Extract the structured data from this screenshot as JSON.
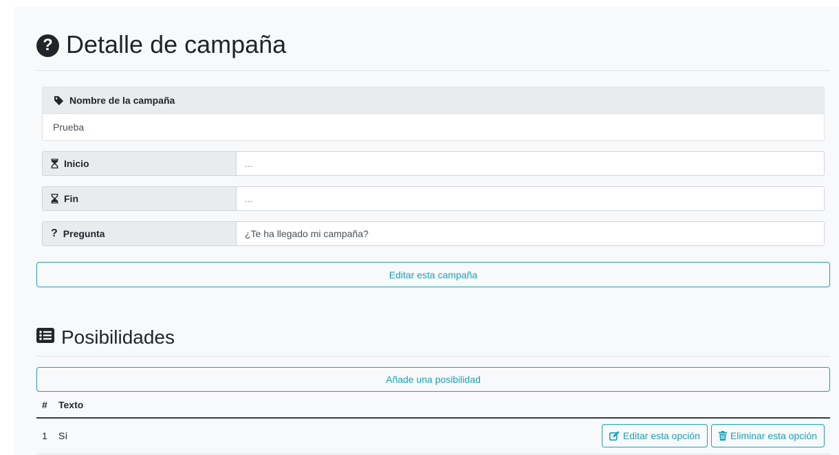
{
  "page": {
    "title": "Detalle de campaña",
    "title_icon": "question-circle-icon"
  },
  "campaign": {
    "name_label": "Nombre de la campaña",
    "name_icon": "tag-icon",
    "name_value": "Prueba",
    "fields": [
      {
        "label": "Inicio",
        "icon": "hourglass-start-icon",
        "value": "..."
      },
      {
        "label": "Fin",
        "icon": "hourglass-end-icon",
        "value": "..."
      },
      {
        "label": "Pregunta",
        "icon": "question-icon",
        "value": "¿Te ha llegado mi campaña?"
      }
    ],
    "edit_button": "Editar esta campaña"
  },
  "possibilities": {
    "title": "Posibilidades",
    "title_icon": "list-alt-icon",
    "add_button": "Añade una posibilidad",
    "columns": [
      "#",
      "Texto"
    ],
    "rows": [
      {
        "num": "1",
        "text": "Sí",
        "edit_label": "Editar esta opción",
        "delete_label": "Eliminar esta opción"
      }
    ]
  },
  "colors": {
    "accent": "#17a2b8",
    "background": "#f8f9fa",
    "label_bg": "#e9ecef"
  }
}
